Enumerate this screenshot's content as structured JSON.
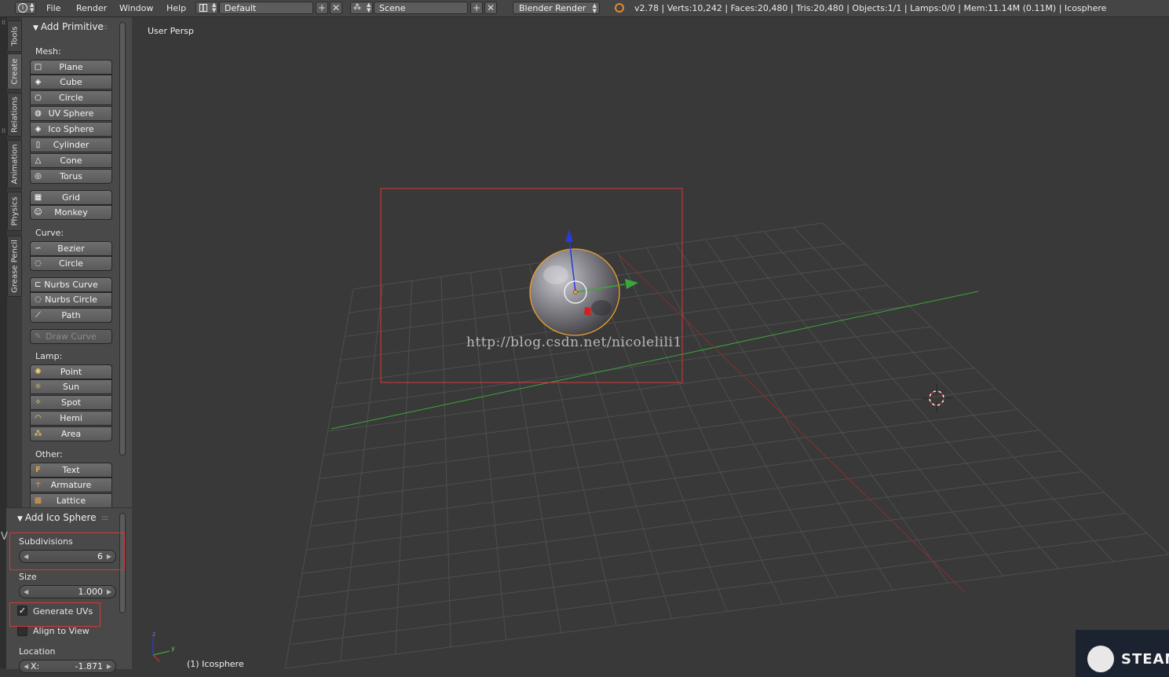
{
  "topbar": {
    "menus": [
      "File",
      "Render",
      "Window",
      "Help"
    ],
    "screen_layout": "Default",
    "scene": "Scene",
    "render_engine": "Blender Render",
    "stats": "v2.78 | Verts:10,242 | Faces:20,480 | Tris:20,480 | Objects:1/1 | Lamps:0/0 | Mem:11.14M (0.11M) | Icosphere"
  },
  "tabs": [
    "Tools",
    "Create",
    "Relations",
    "Animation",
    "Physics",
    "Grease Pencil"
  ],
  "toolshelf": {
    "title": "Add Primitive",
    "mesh_label": "Mesh:",
    "mesh": [
      "Plane",
      "Cube",
      "Circle",
      "UV Sphere",
      "Ico Sphere",
      "Cylinder",
      "Cone",
      "Torus"
    ],
    "mesh2": [
      "Grid",
      "Monkey"
    ],
    "curve_label": "Curve:",
    "curve": [
      "Bezier",
      "Circle"
    ],
    "curve2": [
      "Nurbs Curve",
      "Nurbs Circle",
      "Path"
    ],
    "draw_curve": "Draw Curve",
    "lamp_label": "Lamp:",
    "lamp": [
      "Point",
      "Sun",
      "Spot",
      "Hemi",
      "Area"
    ],
    "other_label": "Other:",
    "other": [
      "Text",
      "Armature",
      "Lattice"
    ]
  },
  "operator": {
    "title": "Add Ico Sphere",
    "subdivisions_label": "Subdivisions",
    "subdivisions_value": "6",
    "size_label": "Size",
    "size_value": "1.000",
    "generate_uvs": "Generate UVs",
    "generate_uvs_checked": true,
    "align_to_view": "Align to View",
    "align_to_view_checked": false,
    "location_label": "Location",
    "location_x_label": "X:",
    "location_x": "-1.871"
  },
  "viewport": {
    "label": "User Persp",
    "object_name": "(1) Icosphere",
    "watermark": "http://blog.csdn.net/nicolelili1",
    "steam_text": "STEAM"
  },
  "colors": {
    "annotation_red": "#d23a3a",
    "selection_orange": "#f0a030",
    "axis_x": "#c03030",
    "axis_y": "#3ca63c",
    "axis_z": "#2a3ad8"
  }
}
